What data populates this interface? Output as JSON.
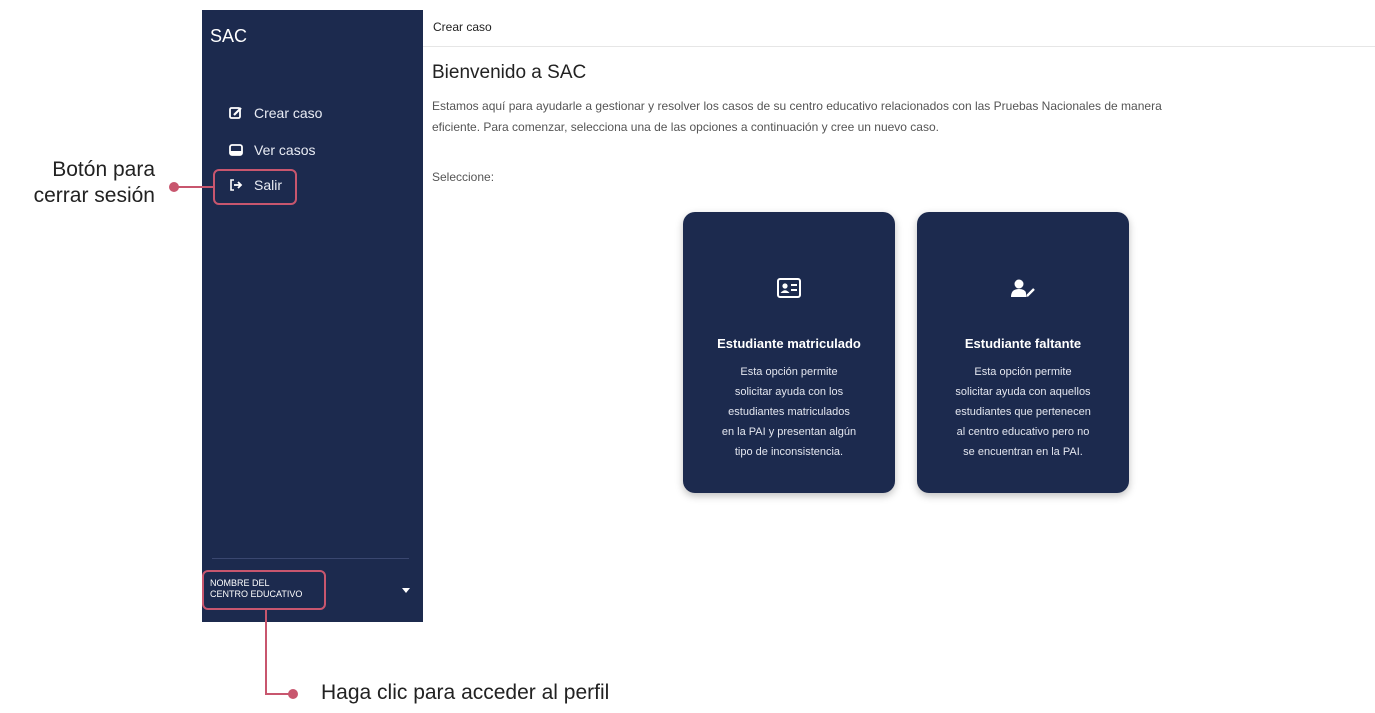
{
  "sidebar": {
    "brand": "SAC",
    "items": [
      {
        "label": "Crear caso",
        "icon": "edit-icon"
      },
      {
        "label": "Ver casos",
        "icon": "inbox-icon"
      },
      {
        "label": "Salir",
        "icon": "sign-out-icon"
      }
    ],
    "profile": {
      "line1": "NOMBRE DEL",
      "line2": "CENTRO EDUCATIVO",
      "icon": "caret-down-icon"
    }
  },
  "breadcrumb": "Crear caso",
  "main": {
    "title": "Bienvenido a SAC",
    "intro_line1": "Estamos aquí para ayudarle a gestionar y resolver los casos de su centro educativo relacionados con las Pruebas Nacionales de manera",
    "intro_line2": "eficiente. Para comenzar, selecciona una de las opciones a continuación y cree un nuevo caso.",
    "select_label": "Seleccione:",
    "cards": [
      {
        "icon": "id-card-icon",
        "title": "Estudiante matriculado",
        "lines": [
          "Esta opción permite",
          "solicitar ayuda con los",
          "estudiantes matriculados",
          "en la PAI y presentan algún",
          "tipo de inconsistencia."
        ]
      },
      {
        "icon": "user-edit-icon",
        "title": "Estudiante faltante",
        "lines": [
          "Esta opción permite",
          "solicitar ayuda con aquellos",
          "estudiantes que pertenecen",
          "al centro educativo pero no",
          "se encuentran en la PAI."
        ]
      }
    ]
  },
  "annotations": {
    "logout_line1": "Botón para",
    "logout_line2": "cerrar sesión",
    "profile_hint": "Haga clic para acceder al perfil"
  },
  "colors": {
    "sidebar_bg": "#1c2a4e",
    "card_bg": "#1c2a4e",
    "annotation": "#c8566e"
  }
}
